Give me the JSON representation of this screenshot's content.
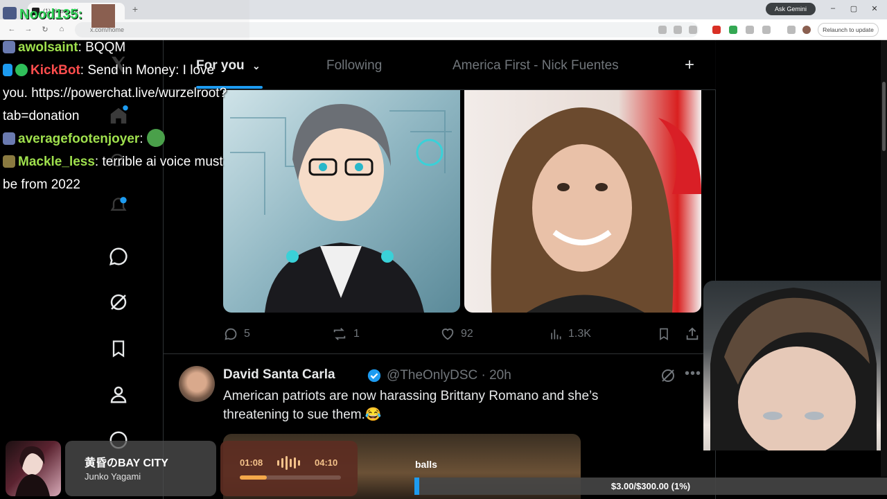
{
  "browser": {
    "tab_title": "(1) Home / X",
    "url": "x.com/home",
    "ask_gemini": "Ask Gemini",
    "relaunch": "Relaunch to update"
  },
  "stream": {
    "streamer_name": "Nood135:"
  },
  "chat": [
    {
      "user": "awolsaint",
      "user_color": "#9fe04d",
      "message": "BQQM"
    },
    {
      "user": "KickBot",
      "user_color": "#ff4d4d",
      "message": "Send in Money: I love you. https://powerchat.live/wurzelroot?tab=donation"
    },
    {
      "user": "averagefootenjoyer",
      "user_color": "#9fe04d",
      "message": ""
    },
    {
      "user": "Mackle_less",
      "user_color": "#9fe04d",
      "message": "terrible ai voice must be from 2022"
    }
  ],
  "feed": {
    "tabs": [
      "For you",
      "Following",
      "America First - Nick Fuentes"
    ],
    "add_tab": "+"
  },
  "post1": {
    "replies": "5",
    "reposts": "1",
    "likes": "92",
    "views": "1.3K"
  },
  "post2": {
    "name": "David Santa Carla",
    "handle_time": "@TheOnlyDSC · 20h",
    "text": "American patriots are now harassing Brittany Romano and she’s threatening to sue them.😂"
  },
  "music": {
    "title": "黄昏のBAY CITY",
    "artist": "Junko Yagami",
    "current": "01:08",
    "total": "04:10",
    "progress": 0.27
  },
  "goal": {
    "label": "balls",
    "text": "$3.00/$300.00 (1%)",
    "progress": 0.01
  },
  "colors": {
    "accent": "#1d9bf0",
    "verified": "#1d9bf0"
  }
}
